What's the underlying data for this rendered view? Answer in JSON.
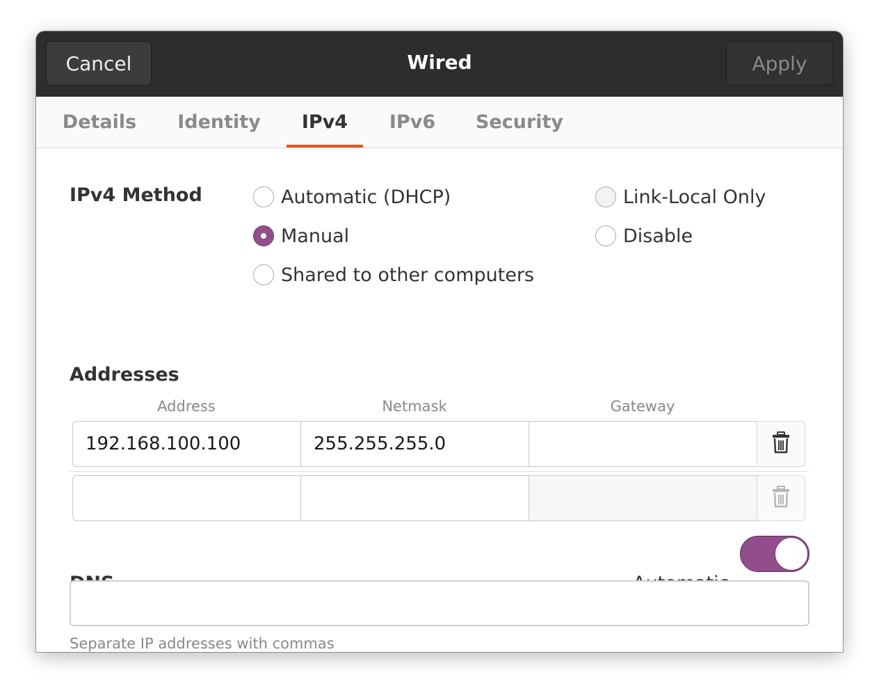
{
  "header": {
    "title": "Wired",
    "cancel_label": "Cancel",
    "apply_label": "Apply"
  },
  "tabs": [
    {
      "label": "Details"
    },
    {
      "label": "Identity"
    },
    {
      "label": "IPv4",
      "active": true
    },
    {
      "label": "IPv6"
    },
    {
      "label": "Security"
    }
  ],
  "ipv4_method": {
    "label": "IPv4 Method",
    "options": [
      {
        "label": "Automatic (DHCP)",
        "selected": false
      },
      {
        "label": "Manual",
        "selected": true
      },
      {
        "label": "Shared to other computers",
        "selected": false
      },
      {
        "label": "Link-Local Only",
        "selected": false
      },
      {
        "label": "Disable",
        "selected": false
      }
    ]
  },
  "addresses": {
    "label": "Addresses",
    "columns": [
      "Address",
      "Netmask",
      "Gateway"
    ],
    "rows": [
      {
        "address": "192.168.100.100",
        "netmask": "255.255.255.0",
        "gateway": ""
      },
      {
        "address": "",
        "netmask": "",
        "gateway": ""
      }
    ],
    "delete_icon": "trash-icon"
  },
  "dns": {
    "label": "DNS",
    "automatic_label": "Automatic",
    "automatic_on": true,
    "value": "",
    "hint": "Separate IP addresses with commas"
  },
  "colors": {
    "accent_tab": "#e95420",
    "accent_selection": "#924d8b",
    "header_bg": "#2d2d2d"
  }
}
